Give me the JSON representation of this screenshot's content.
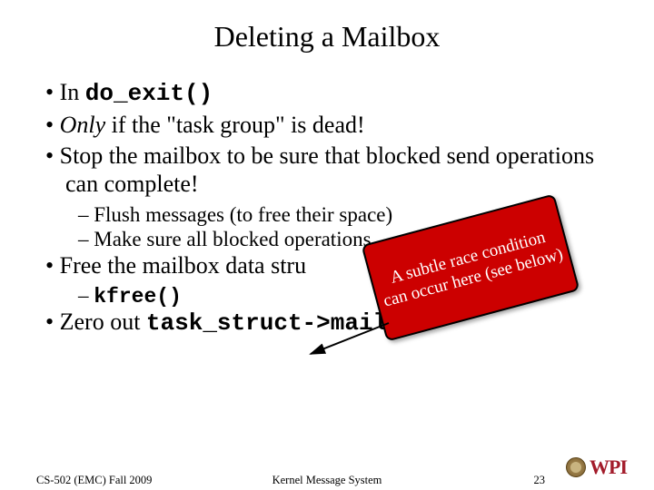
{
  "title": "Deleting a Mailbox",
  "bullets": {
    "b1_prefix": "In ",
    "b1_code": "do_exit()",
    "b2_only": "Only",
    "b2_rest": " if the \"task group\" is dead!",
    "b3": "Stop the mailbox to be sure that blocked send operations can complete!",
    "b3_s1": "Flush messages (to free their space)",
    "b3_s2": "Make sure all blocked operations",
    "b4": "Free the mailbox data stru",
    "b4_s1_code": "kfree()",
    "b5_prefix": "Zero out ",
    "b5_code": "task_struct->mailbox"
  },
  "callout": "A subtle race condition can occur here (see below)",
  "footer": {
    "left": "CS-502 (EMC) Fall 2009",
    "center": "Kernel Message System",
    "right": "23",
    "logo_text": "WPI"
  }
}
